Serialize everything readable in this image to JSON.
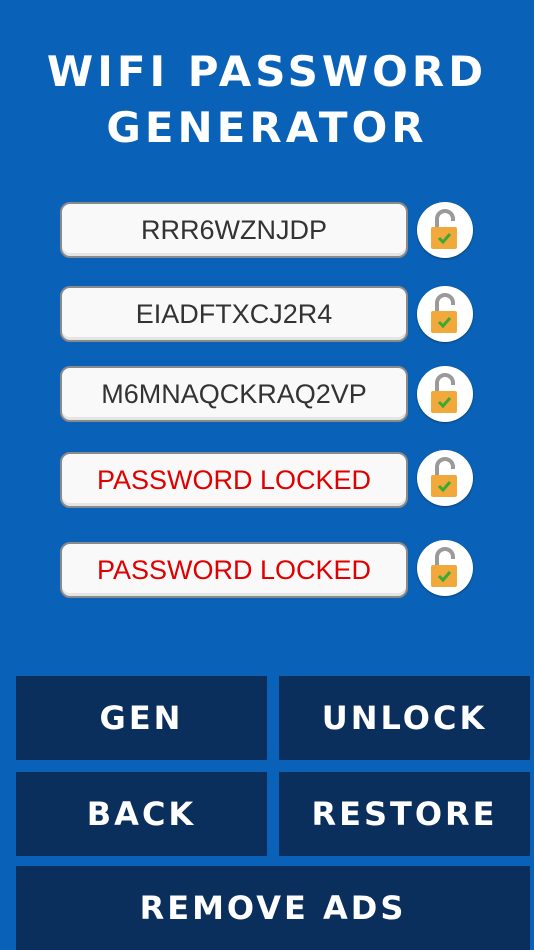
{
  "header": {
    "title_line1": "WIFI PASSWORD",
    "title_line2": "GENERATOR"
  },
  "passwords": [
    {
      "text": "RRR6WZNJDP",
      "locked": false
    },
    {
      "text": "EIADFTXCJ2R4",
      "locked": false
    },
    {
      "text": "M6MNAQCKRAQ2VP",
      "locked": false
    },
    {
      "text": "PASSWORD LOCKED",
      "locked": true
    },
    {
      "text": "PASSWORD LOCKED",
      "locked": true
    }
  ],
  "colors": {
    "background": "#0a62b8",
    "button": "#0b2f5c",
    "locked_text": "#e00000",
    "lock_body": "#f2a93b",
    "check": "#3aa935"
  },
  "icons": {
    "lock": "unlocked-padlock-icon"
  },
  "buttons": {
    "gen": "GEN",
    "unlock": "UNLOCK",
    "back": "BACK",
    "restore": "RESTORE",
    "remove_ads": "REMOVE ADS"
  }
}
